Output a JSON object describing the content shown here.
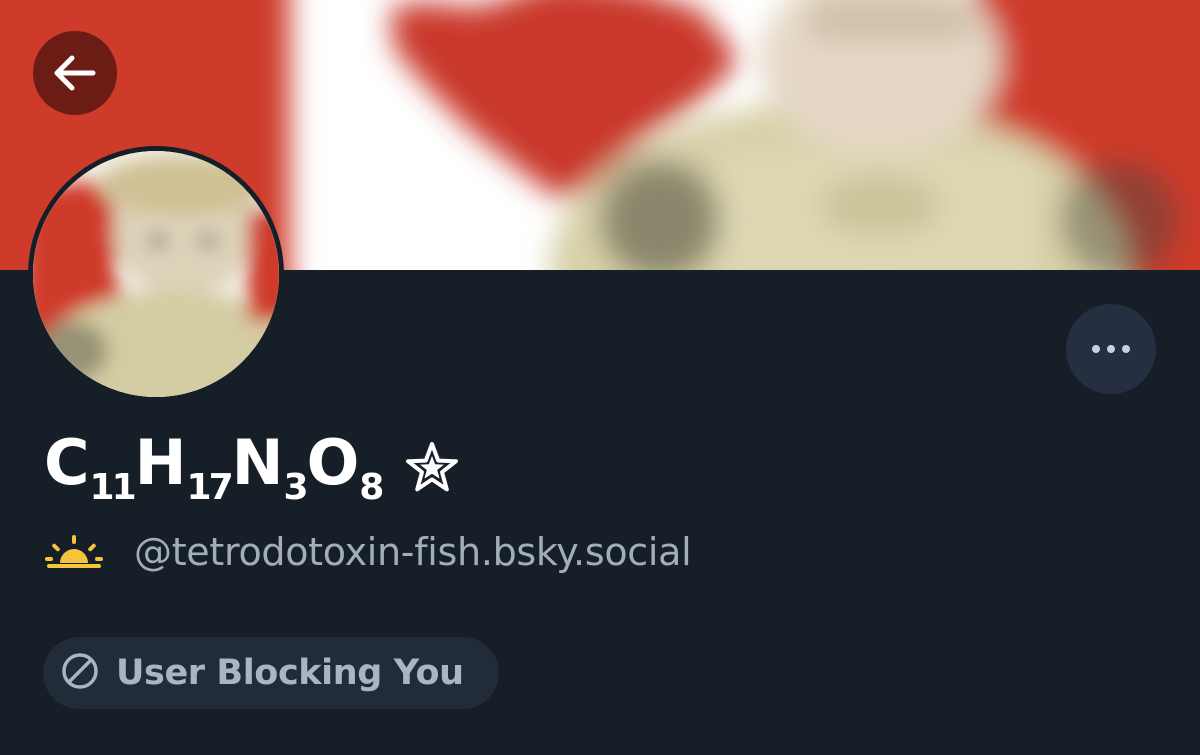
{
  "profile": {
    "display_name": {
      "parts": [
        {
          "text": "C",
          "sub": "11"
        },
        {
          "text": "H",
          "sub": "17"
        },
        {
          "text": "N",
          "sub": "3"
        },
        {
          "text": "O",
          "sub": "8"
        }
      ],
      "badge_icon": "star-icon"
    },
    "handle": "@tetrodotoxin-fish.bsky.social",
    "handle_prefix_icon": "sun-icon",
    "block_status": {
      "label": "User Blocking You",
      "icon": "block-icon"
    }
  },
  "header": {
    "back_icon": "arrow-left-icon",
    "more_icon": "ellipsis-icon"
  },
  "colors": {
    "background": "#161e27",
    "banner_red": "#cf3a2a",
    "back_button_bg": "#6a1c15",
    "more_button_bg": "#252f41",
    "pill_bg": "#222b38",
    "handle_text": "#a1adbd",
    "sun_yellow": "#f4c43a"
  }
}
